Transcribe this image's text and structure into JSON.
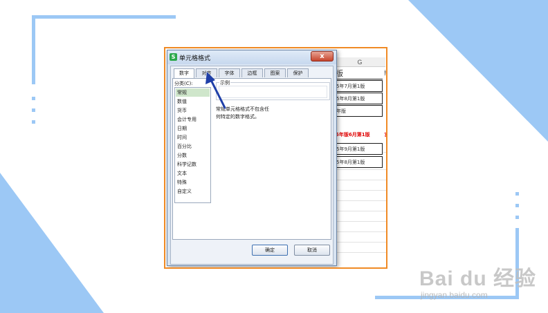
{
  "colors": {
    "background_accent": "#9cc8f5",
    "frame_border": "#f08a24",
    "arrow": "#1f3fa8",
    "highlight_red": "#e00000",
    "selected_item": "#cfe6cb"
  },
  "watermark": {
    "logo_text": "Bai du 经验",
    "url": "jingyan.baidu.com"
  },
  "spreadsheet": {
    "column_letter": "G",
    "header_cell": "版",
    "header_side": "排",
    "rows": [
      {
        "text": "5年7月第1版",
        "style": "normal"
      },
      {
        "text": "5年8月第1版",
        "style": "normal"
      },
      {
        "text": "年版",
        "style": "normal"
      },
      {
        "text": "5年版6月第1版",
        "style": "red",
        "side": "?"
      },
      {
        "text": "5年9月第1版",
        "style": "normal"
      },
      {
        "text": "5年8月第1版",
        "style": "normal"
      }
    ]
  },
  "dialog": {
    "title": "单元格格式",
    "close_label": "x",
    "app_icon_label": "S",
    "tabs": [
      {
        "label": "数字",
        "active": true
      },
      {
        "label": "对齐",
        "active": false
      },
      {
        "label": "字体",
        "active": false
      },
      {
        "label": "边框",
        "active": false
      },
      {
        "label": "图案",
        "active": false
      },
      {
        "label": "保护",
        "active": false
      }
    ],
    "category_label": "分类(C):",
    "categories": [
      "常规",
      "数值",
      "货币",
      "会计专用",
      "日期",
      "时间",
      "百分比",
      "分数",
      "科学记数",
      "文本",
      "特殊",
      "自定义"
    ],
    "selected_category": "常规",
    "sample_label": "示例",
    "description_lines": [
      "常规单元格格式不包含任",
      "何特定的数字格式。"
    ],
    "ok_label": "确定",
    "cancel_label": "取消"
  },
  "annotation": {
    "arrow_target": "对齐",
    "arrow_icon": "blue-pointer-arrow"
  }
}
